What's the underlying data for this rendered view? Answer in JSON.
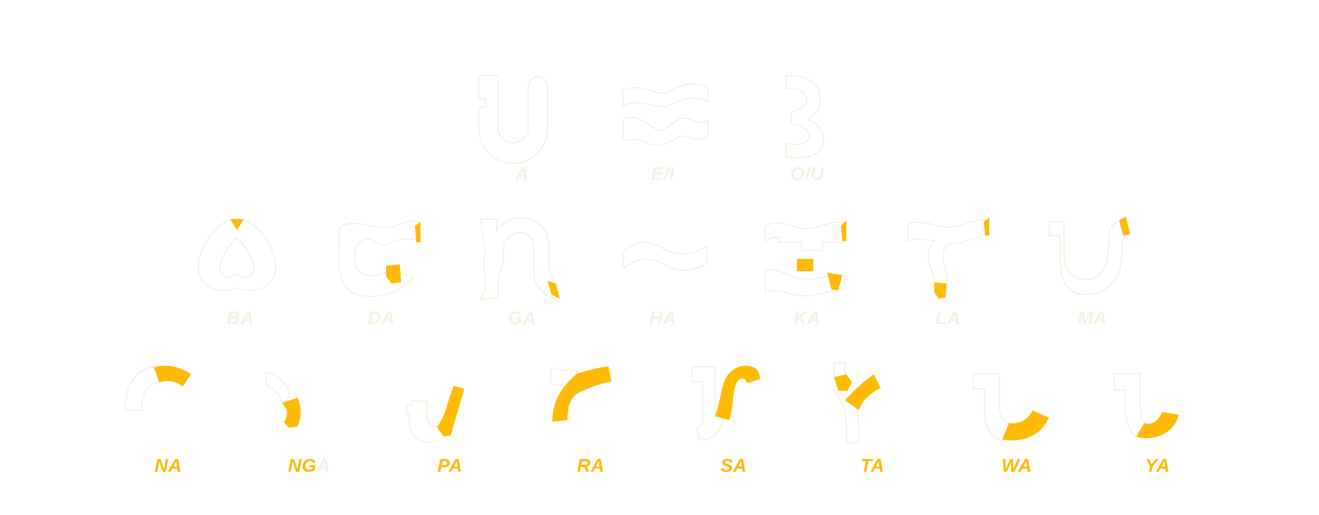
{
  "colors": {
    "accent": "#ffba08",
    "outline": "#f3edd8",
    "background": "#ffffff"
  },
  "rows": {
    "vowels": [
      {
        "id": "a",
        "label": "A"
      },
      {
        "id": "ei",
        "label": "E/I"
      },
      {
        "id": "ou",
        "label": "O/U"
      }
    ],
    "consonants_1": [
      {
        "id": "ba",
        "label": "BA",
        "progress": 0.05
      },
      {
        "id": "da",
        "label": "DA",
        "progress": 0.15
      },
      {
        "id": "ga",
        "label": "GA",
        "progress": 0.1
      },
      {
        "id": "ha",
        "label": "HA",
        "progress": 0
      },
      {
        "id": "ka",
        "label": "KA",
        "progress": 0.15
      },
      {
        "id": "la",
        "label": "LA",
        "progress": 0.15
      },
      {
        "id": "ma",
        "label": "MA",
        "progress": 0.1
      }
    ],
    "consonants_2": [
      {
        "id": "na",
        "label": "NA",
        "progress": 0.6
      },
      {
        "id": "nga",
        "label": "NG",
        "label_tail": "A",
        "progress": 0.5
      },
      {
        "id": "pa",
        "label": "PA",
        "progress": 0.6
      },
      {
        "id": "ra",
        "label": "RA",
        "progress": 0.7
      },
      {
        "id": "sa",
        "label": "SA",
        "progress": 0.6
      },
      {
        "id": "ta",
        "label": "TA",
        "progress": 0.6
      },
      {
        "id": "wa",
        "label": "WA",
        "progress": 0.5
      },
      {
        "id": "ya",
        "label": "YA",
        "progress": 0.5
      }
    ]
  }
}
